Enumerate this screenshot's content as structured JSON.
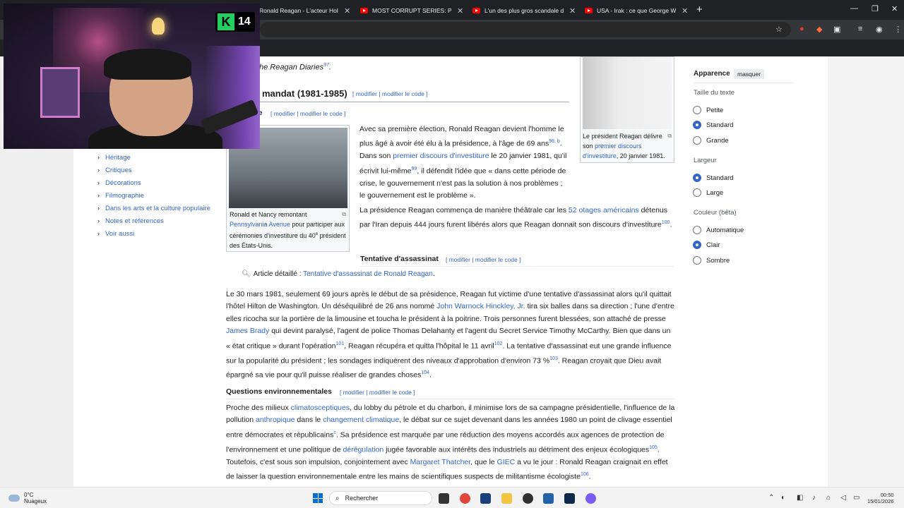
{
  "browser": {
    "tabs": [
      {
        "title": "Ronald Reagan - L'acteur Holly"
      },
      {
        "title": "MOST CORRUPT SERIES: Presid"
      },
      {
        "title": "L'un des plus gros scandale de"
      },
      {
        "title": "USA - Irak : ce que George W B"
      }
    ],
    "new_tab": "+",
    "minimize": "—",
    "maximize": "❐",
    "close": "✕"
  },
  "webcam": {
    "badge_letter": "K",
    "badge_number": "14"
  },
  "toc": {
    "items": [
      {
        "label": "Héritage"
      },
      {
        "label": "Critiques"
      },
      {
        "label": "Décorations"
      },
      {
        "label": "Filmographie"
      },
      {
        "label": "Dans les arts et la culture populaire"
      },
      {
        "label": "Notes et références"
      },
      {
        "label": "Voir aussi"
      }
    ]
  },
  "article": {
    "pretext": "he Reagan Diaries",
    "pretext_ref": "97",
    "h2": "mandat (1981-1985)",
    "h2_edit": "[ modifier | modifier le code ]",
    "h3a_fragment": "e",
    "h3a_edit": "[ modifier | modifier le code ]",
    "fig1_caption_a": "Ronald et Nancy remontant ",
    "fig1_caption_link": "Pennsylvania Avenue",
    "fig1_caption_b": " pour participer aux cérémonies d'investiture du 40",
    "fig1_caption_sup": "e",
    "fig1_caption_c": " président des États-Unis.",
    "fig2_caption_a": "Le président Reagan délivre son ",
    "fig2_caption_link": "premier discours d'investiture",
    "fig2_caption_b": ", 20 janvier 1981.",
    "p1_a": "Avec sa première élection, Ronald Reagan devient l'homme le plus âgé à avoir été élu à la présidence, à l'âge de 69 ans",
    "p1_ref1": "98, b",
    "p1_b": ". Dans son ",
    "p1_link": "premier discours d'investiture",
    "p1_c": " le 20 janvier 1981, qu'il écrivit lui-même",
    "p1_ref2": "99",
    "p1_d": ", il défendit l'idée que « dans cette période de crise, le gouvernement n'est pas la solution à nos problèmes ; le gouvernement est le problème ».",
    "p2_a": "La présidence Reagan commença de manière théâtrale car les ",
    "p2_link": "52 otages américains",
    "p2_b": " détenus par l'Iran depuis 444 jours furent libérés alors que Reagan donnait son discours d'investiture",
    "p2_ref": "100",
    "p2_c": ".",
    "h3_assassinat": "Tentative d'assassinat",
    "h3_assassinat_edit": "[ modifier | modifier le code ]",
    "hatnote_label": "Article détaillé : ",
    "hatnote_link": "Tentative d'assassinat de Ronald Reagan",
    "hatnote_end": ".",
    "p3_a": "Le 30 mars 1981, seulement 69 jours après le début de sa présidence, Reagan fut victime d'une tentative d'assassinat alors qu'il quittait l'hôtel Hilton de Washington. Un déséquilibré de 26 ans nommé ",
    "p3_link1": "John Warnock Hinckley, Jr.",
    "p3_b": " tira six balles dans sa direction ; l'une d'entre elles ricocha sur la portière de la limousine et toucha le président à la poitrine. Trois personnes furent blessées, son attaché de presse ",
    "p3_link2": "James Brady",
    "p3_c": " qui devint paralysé, l'agent de police Thomas Delahanty et l'agent du Secret Service Timothy McCarthy. Bien que dans un « état critique » durant l'opération",
    "p3_ref1": "101",
    "p3_d": ", Reagan récupéra et quitta l'hôpital le 11 avril",
    "p3_ref2": "102",
    "p3_e": ". La tentative d'assassinat eut une grande influence sur la popularité du président ; les sondages indiquèrent des niveaux d'approbation d'environ 73 %",
    "p3_ref3": "103",
    "p3_f": ". Reagan croyait que Dieu avait épargné sa vie pour qu'il puisse réaliser de grandes choses",
    "p3_ref4": "104",
    "p3_g": ".",
    "h3_env": "Questions environnementales",
    "h3_env_edit": "[ modifier | modifier le code ]",
    "p4_a": "Proche des milieux ",
    "p4_link1": "climatosceptiques",
    "p4_b": ", du lobby du pétrole et du charbon, il minimise lors de sa campagne présidentielle, l'influence de la pollution ",
    "p4_link2": "anthropique",
    "p4_c": " dans le ",
    "p4_link3": "changement climatique",
    "p4_d": ", le débat sur ce sujet devenant dans les années 1980 un point de clivage essentiel entre démocrates et républicains",
    "p4_ref1": "c",
    "p4_e": ". Sa présidence est marquée par une réduction des moyens accordés aux agences de protection de l'environnement et une politique de ",
    "p4_link4": "dérégulation",
    "p4_f": " jugée favorable aux intérêts des industriels au détriment des enjeux écologiques",
    "p4_ref2": "105",
    "p4_g": ". Toutefois, c'est sous son impulsion, conjointement avec ",
    "p4_link5": "Margaret Thatcher",
    "p4_h": ", que le ",
    "p4_link6": "GIEC",
    "p4_i": " a vu le jour : Ronald Reagan craignait en effet de laisser la question environnementale entre les mains de scientifiques suspects de militantisme écologiste",
    "p4_ref3": "106",
    "p4_j": "."
  },
  "appearance": {
    "title": "Apparence",
    "hide": "masquer",
    "text_size_label": "Taille du texte",
    "text_sizes": [
      {
        "label": "Petite",
        "checked": false
      },
      {
        "label": "Standard",
        "checked": true
      },
      {
        "label": "Grande",
        "checked": false
      }
    ],
    "width_label": "Largeur",
    "widths": [
      {
        "label": "Standard",
        "checked": true
      },
      {
        "label": "Large",
        "checked": false
      }
    ],
    "color_label": "Couleur (bêta)",
    "colors": [
      {
        "label": "Automatique",
        "checked": false
      },
      {
        "label": "Clair",
        "checked": true
      },
      {
        "label": "Sombre",
        "checked": false
      }
    ]
  },
  "taskbar": {
    "temp": "0°C",
    "weather": "Nuageux",
    "search_placeholder": "Rechercher",
    "time": "00:50",
    "date": "15/01/2026"
  }
}
